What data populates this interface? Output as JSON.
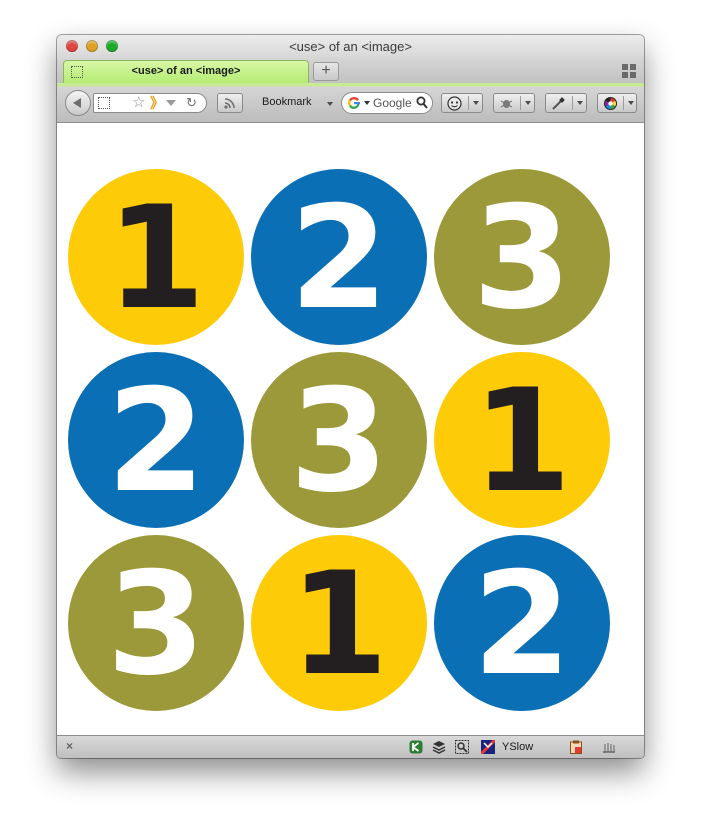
{
  "window": {
    "title": "<use> of an <image>"
  },
  "tabs": [
    {
      "label": "<use> of an <image>",
      "active": true
    }
  ],
  "new_tab_label": "+",
  "toolbar": {
    "bookmark_label": "Bookmark",
    "search_text": "Google"
  },
  "status_bar": {
    "close_glyph": "×",
    "yslow_label": "YSlow"
  },
  "colors": {
    "yellow": "#fecb08",
    "blue": "#0b6fb6",
    "olive": "#9c993a",
    "dark_digit": "#231f20",
    "light_digit": "#ffffff"
  },
  "grid": [
    [
      {
        "digit": "1",
        "fill": "yellow",
        "digit_color": "dark_digit"
      },
      {
        "digit": "2",
        "fill": "blue",
        "digit_color": "light_digit"
      },
      {
        "digit": "3",
        "fill": "olive",
        "digit_color": "light_digit"
      }
    ],
    [
      {
        "digit": "2",
        "fill": "blue",
        "digit_color": "light_digit"
      },
      {
        "digit": "3",
        "fill": "olive",
        "digit_color": "light_digit"
      },
      {
        "digit": "1",
        "fill": "yellow",
        "digit_color": "dark_digit"
      }
    ],
    [
      {
        "digit": "3",
        "fill": "olive",
        "digit_color": "light_digit"
      },
      {
        "digit": "1",
        "fill": "yellow",
        "digit_color": "dark_digit"
      },
      {
        "digit": "2",
        "fill": "blue",
        "digit_color": "light_digit"
      }
    ]
  ],
  "icons": {
    "back": "back-arrow-icon",
    "favicon": "dotted-square-icon",
    "bookmark_star": "star-icon",
    "url_extension": "chevron-icon",
    "reload": "reload-icon",
    "feed": "rss-icon",
    "search_engine": "google-icon",
    "search": "magnifier-icon",
    "ext1": "smiley-icon",
    "ext2": "bug-icon",
    "ext3": "eyedropper-icon",
    "ext4": "color-wheel-icon",
    "status1": "k-icon",
    "status2": "layers-icon",
    "status3": "inspect-icon",
    "status4": "yslow-icon",
    "status5": "clipboard-icon",
    "status6": "firebug-icon"
  }
}
